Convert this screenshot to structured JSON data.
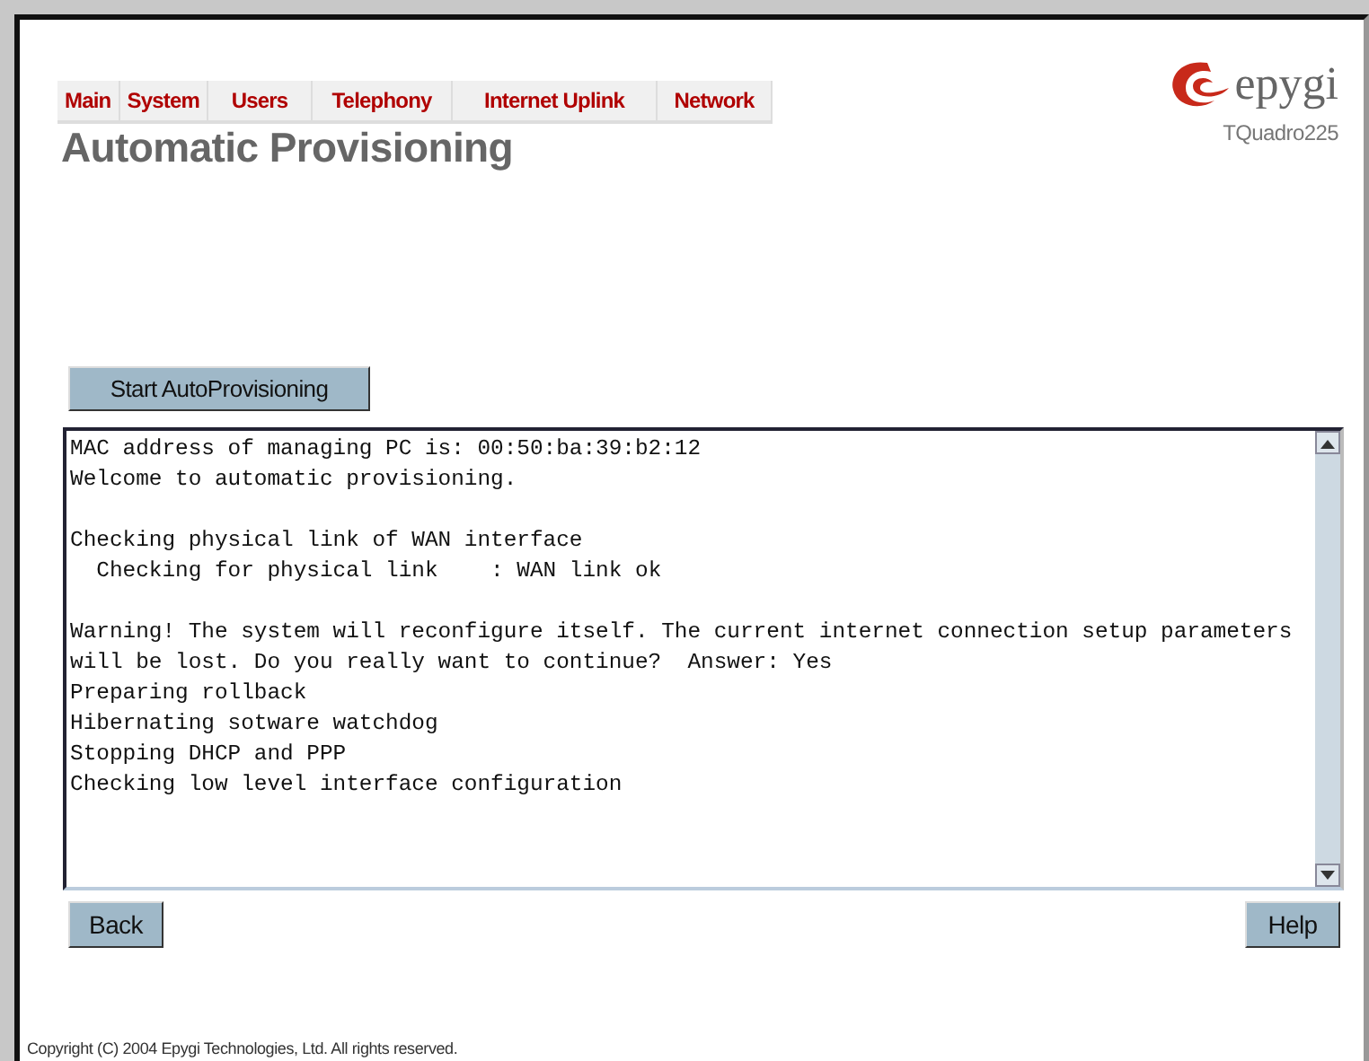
{
  "nav": [
    {
      "label": "Main"
    },
    {
      "label": "System"
    },
    {
      "label": "Users"
    },
    {
      "label": "Telephony"
    },
    {
      "label": "Internet Uplink"
    },
    {
      "label": "Network"
    }
  ],
  "logo": {
    "text": "epygi",
    "model": "TQuadro225"
  },
  "title": "Automatic Provisioning",
  "start_button": "Start AutoProvisioning",
  "log": [
    [
      "MAC address of managing PC is: 00:50:ba:39:b2:12",
      "Welcome to automatic provisioning."
    ],
    [
      "Checking physical link of WAN interface",
      "  Checking for physical link    : WAN link ok"
    ],
    [
      "Warning! The system will reconfigure itself. The current internet connection setup parameters will be lost. Do you really want to continue?  Answer: Yes",
      "Preparing rollback",
      "Hibernating sotware watchdog",
      "Stopping DHCP and PPP",
      "Checking low level interface configuration"
    ]
  ],
  "buttons": {
    "back": "Back",
    "help": "Help"
  },
  "footer": "Copyright (C) 2004 Epygi Technologies, Ltd. All rights reserved."
}
